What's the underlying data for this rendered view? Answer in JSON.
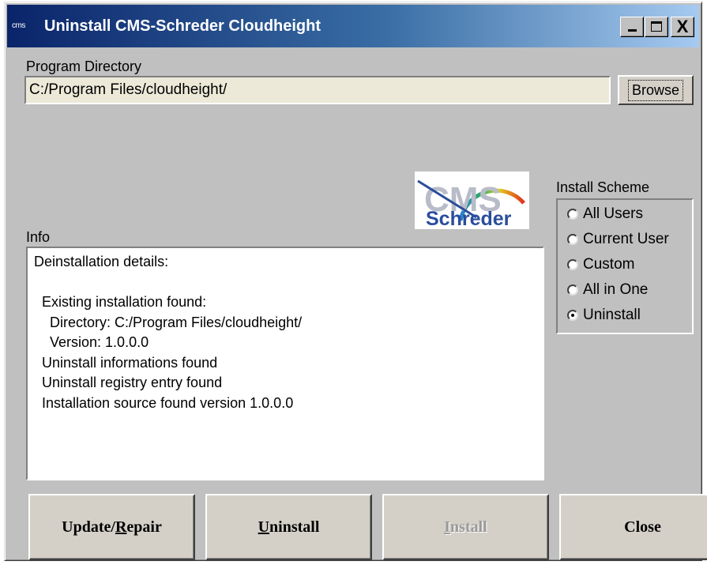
{
  "window": {
    "title": "Uninstall CMS-Schreder Cloudheight",
    "icon_text": "cms",
    "controls": {
      "minimize_icon": "minimize-icon",
      "maximize_icon": "maximize-icon",
      "close_glyph": "X"
    }
  },
  "program_directory": {
    "label": "Program Directory",
    "value": "C:/Program Files/cloudheight/",
    "browse_label": "Browse"
  },
  "logo": {
    "text": "Schreder",
    "arc_text": "CMS"
  },
  "install_scheme": {
    "label": "Install Scheme",
    "options": [
      {
        "label": "All Users",
        "checked": false
      },
      {
        "label": "Current User",
        "checked": false
      },
      {
        "label": "Custom",
        "checked": false
      },
      {
        "label": "All in One",
        "checked": false
      },
      {
        "label": "Uninstall",
        "checked": true
      }
    ]
  },
  "info": {
    "label": "Info",
    "lines": [
      "Deinstallation details:",
      "",
      "  Existing installation found:",
      "    Directory: C:/Program Files/cloudheight/",
      "    Version: 1.0.0.0",
      "  Uninstall informations found",
      "  Uninstall registry entry found",
      "  Installation source found version 1.0.0.0"
    ]
  },
  "buttons": {
    "update_repair": {
      "before": "Update/",
      "mnemonic": "R",
      "after": "epair",
      "enabled": true
    },
    "uninstall": {
      "before": "",
      "mnemonic": "U",
      "after": "ninstall",
      "enabled": true
    },
    "install": {
      "before": "",
      "mnemonic": "I",
      "after": "nstall",
      "enabled": false
    },
    "close": {
      "before": "Close",
      "mnemonic": "",
      "after": "",
      "enabled": true
    }
  },
  "colors": {
    "title_gradient_start": "#0a246a",
    "title_gradient_end": "#a6caf0",
    "face": "#c0c0c0",
    "input_bg": "#ece9d8",
    "logo_blue": "#2a4d9c"
  }
}
